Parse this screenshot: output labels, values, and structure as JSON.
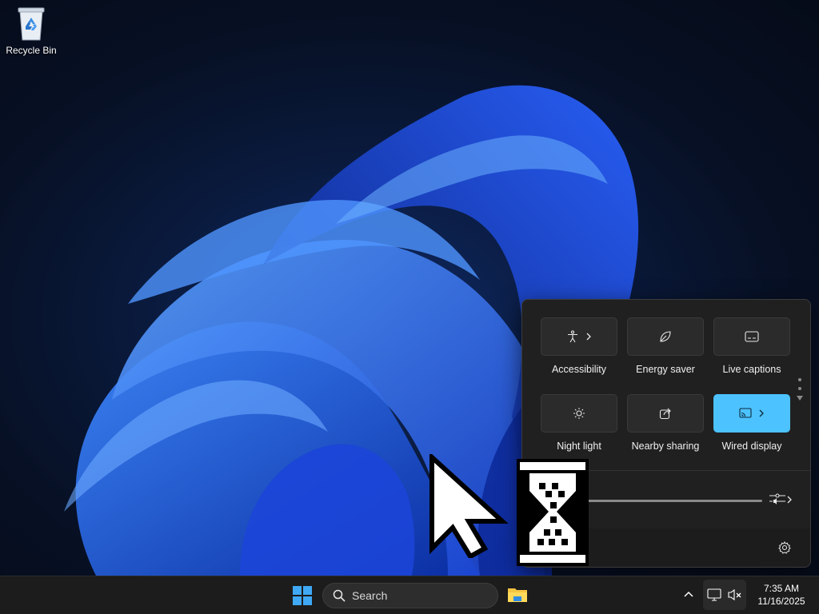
{
  "desktop": {
    "icons": [
      {
        "label": "Recycle Bin",
        "icon": "recycle-bin-icon"
      }
    ]
  },
  "quick_settings": {
    "tiles": [
      {
        "label": "Accessibility",
        "icon": "accessibility-icon",
        "has_chevron": true,
        "active": false
      },
      {
        "label": "Energy saver",
        "icon": "leaf-icon",
        "has_chevron": false,
        "active": false
      },
      {
        "label": "Live captions",
        "icon": "captions-icon",
        "has_chevron": false,
        "active": false
      },
      {
        "label": "Night light",
        "icon": "sun-icon",
        "has_chevron": false,
        "active": false
      },
      {
        "label": "Nearby sharing",
        "icon": "share-icon",
        "has_chevron": false,
        "active": false
      },
      {
        "label": "Wired display",
        "icon": "cast-icon",
        "has_chevron": true,
        "active": true
      }
    ],
    "accent_color": "#4cc2ff",
    "settings_icon": "gear-icon"
  },
  "taskbar": {
    "search_placeholder": "Search",
    "clock": {
      "time": "7:35 AM",
      "date": "11/16/2025"
    },
    "tray_icons": [
      "chevron-up-icon",
      "network-icon",
      "volume-muted-icon"
    ]
  }
}
